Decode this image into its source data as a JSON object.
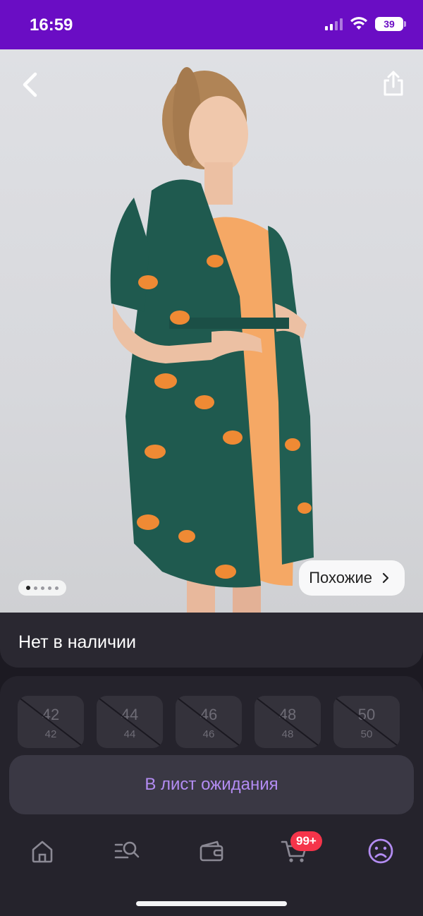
{
  "status": {
    "time": "16:59",
    "battery": "39"
  },
  "product": {
    "availability": "Нет в наличии",
    "similar_label": "Похожие",
    "image_count": 5,
    "active_image": 1
  },
  "sizes": [
    {
      "size": "42",
      "alt": "42",
      "available": false
    },
    {
      "size": "44",
      "alt": "44",
      "available": false
    },
    {
      "size": "46",
      "alt": "46",
      "available": false
    },
    {
      "size": "48",
      "alt": "48",
      "available": false
    },
    {
      "size": "50",
      "alt": "50",
      "available": false
    }
  ],
  "actions": {
    "waitlist_label": "В лист ожидания"
  },
  "tabbar": {
    "items": [
      "home",
      "catalog",
      "wallet",
      "cart",
      "profile"
    ],
    "cart_badge": "99+",
    "active_item": "profile"
  },
  "colors": {
    "brand": "#6a0dc4",
    "accent": "#b38cf2",
    "badge": "#f5344a"
  }
}
